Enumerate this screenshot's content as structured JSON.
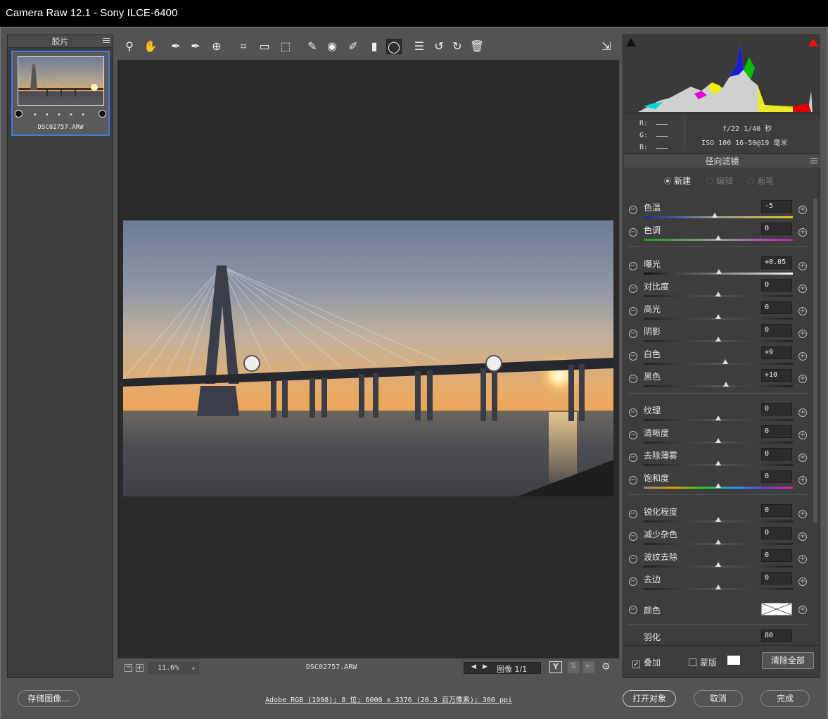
{
  "window": {
    "title": "Camera Raw 12.1 -  Sony ILCE-6400"
  },
  "filmstrip": {
    "header": "胶片",
    "filename": "DSC02757.ARW",
    "dots": "• • • • •"
  },
  "histogram": {
    "r_label": "R:",
    "g_label": "G:",
    "b_label": "B:",
    "aperture_shutter": "f/22  1/40 秒",
    "iso_lens": "ISO 100  16-50@19 毫米"
  },
  "panel": {
    "title": "径向滤镜",
    "modes": [
      {
        "label": "新建",
        "selected": true
      },
      {
        "label": "编辑",
        "selected": false
      },
      {
        "label": "画笔",
        "selected": false
      }
    ],
    "sliders": [
      {
        "label": "色温",
        "value": "-5",
        "pos": -5,
        "track": "temp"
      },
      {
        "label": "色调",
        "value": "0",
        "pos": 0,
        "track": "tint"
      },
      {
        "label": "曝光",
        "value": "+0.05",
        "pos": 0.05,
        "track": "bw"
      },
      {
        "label": "对比度",
        "value": "0",
        "pos": 0,
        "track": "gray"
      },
      {
        "label": "高光",
        "value": "0",
        "pos": 0,
        "track": "gray"
      },
      {
        "label": "阴影",
        "value": "0",
        "pos": 0,
        "track": "gray"
      },
      {
        "label": "白色",
        "value": "+9",
        "pos": 9,
        "track": "gray"
      },
      {
        "label": "黑色",
        "value": "+10",
        "pos": 10,
        "track": "gray"
      },
      {
        "label": "纹理",
        "value": "0",
        "pos": 0,
        "track": "gray"
      },
      {
        "label": "清晰度",
        "value": "0",
        "pos": 0,
        "track": "gray"
      },
      {
        "label": "去除薄雾",
        "value": "0",
        "pos": 0,
        "track": "gray"
      },
      {
        "label": "饱和度",
        "value": "0",
        "pos": 0,
        "track": "sat"
      },
      {
        "label": "锐化程度",
        "value": "0",
        "pos": 0,
        "track": "gray"
      },
      {
        "label": "减少杂色",
        "value": "0",
        "pos": 0,
        "track": "gray"
      },
      {
        "label": "波纹去除",
        "value": "0",
        "pos": 0,
        "track": "gray"
      },
      {
        "label": "去边",
        "value": "0",
        "pos": 0,
        "track": "gray"
      }
    ],
    "color_label": "颜色",
    "feather_label": "羽化",
    "feather_value": "80"
  },
  "options": {
    "overlay": "叠加",
    "overlay_checked": true,
    "mask": "蒙版",
    "mask_checked": false,
    "clear_all": "清除全部"
  },
  "statusbar": {
    "zoom": "11.6%",
    "filename": "DSC02757.ARW",
    "image_counter": "图像 1/1",
    "y_button": "Y"
  },
  "footer": {
    "save": "存储图像...",
    "workflow": "Adobe RGB (1998); 8 位; 6000 x 3376 (20.3 百万像素); 300 ppi",
    "open": "打开对象",
    "cancel": "取消",
    "done": "完成"
  },
  "colors": {
    "accent": "#3f7fd8",
    "panel": "#3d3d3d",
    "bg": "#535353"
  }
}
